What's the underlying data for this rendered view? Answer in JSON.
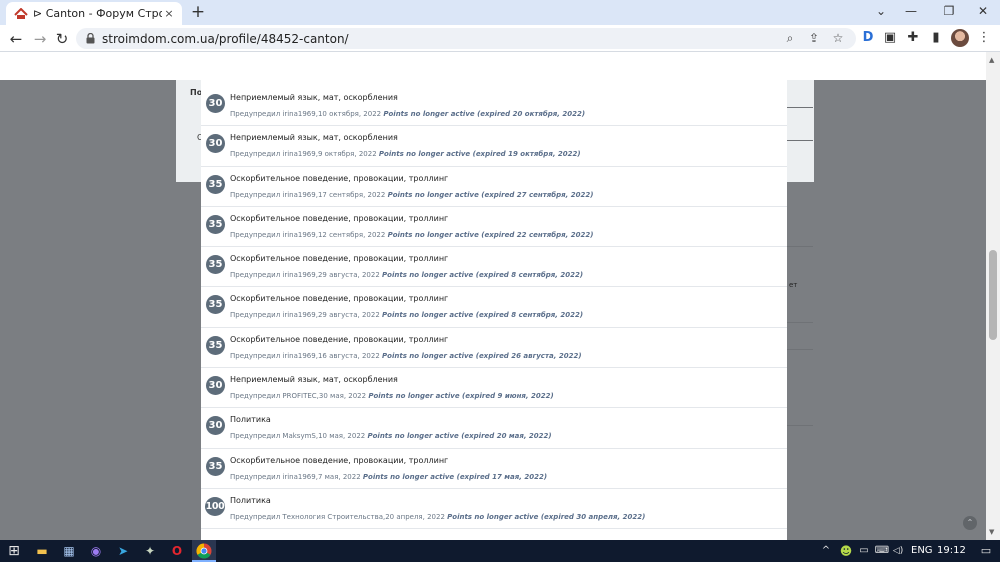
{
  "browser": {
    "tab_title": "⊳ Canton - Форум Строим Дом",
    "tab_close": "×",
    "new_tab": "+",
    "url": "stroimdom.com.ua/profile/48452-canton/",
    "buttons": {
      "back": "←",
      "forward": "→",
      "reload": "↻",
      "minimize": "—",
      "restore": "❐",
      "close": "✕",
      "dropdown": "⌄",
      "menu": "⋮"
    },
    "omnibox_icons": {
      "zoom": "⌕",
      "share": "⇪",
      "bookmark": "☆"
    },
    "extensions": [
      "D",
      "▣",
      "✚",
      "▮"
    ]
  },
  "background": {
    "card_label": "По",
    "letter": "С",
    "side_text": "ет"
  },
  "warnings": [
    {
      "points": "30",
      "reason": "Неприемлемый язык, мат, оскорбления",
      "meta": "Предупредил irina1969,10 октября, 2022",
      "status": "Points no longer active (expired 20 октября, 2022)"
    },
    {
      "points": "30",
      "reason": "Неприемлемый язык, мат, оскорбления",
      "meta": "Предупредил irina1969,9 октября, 2022",
      "status": "Points no longer active (expired 19 октября, 2022)"
    },
    {
      "points": "35",
      "reason": "Оскорбительное поведение, провокации, троллинг",
      "meta": "Предупредил irina1969,17 сентября, 2022",
      "status": "Points no longer active (expired 27 сентября, 2022)"
    },
    {
      "points": "35",
      "reason": "Оскорбительное поведение, провокации, троллинг",
      "meta": "Предупредил irina1969,12 сентября, 2022",
      "status": "Points no longer active (expired 22 сентября, 2022)"
    },
    {
      "points": "35",
      "reason": "Оскорбительное поведение, провокации, троллинг",
      "meta": "Предупредил irina1969,29 августа, 2022",
      "status": "Points no longer active (expired 8 сентября, 2022)"
    },
    {
      "points": "35",
      "reason": "Оскорбительное поведение, провокации, троллинг",
      "meta": "Предупредил irina1969,29 августа, 2022",
      "status": "Points no longer active (expired 8 сентября, 2022)"
    },
    {
      "points": "35",
      "reason": "Оскорбительное поведение, провокации, троллинг",
      "meta": "Предупредил irina1969,16 августа, 2022",
      "status": "Points no longer active (expired 26 августа, 2022)"
    },
    {
      "points": "30",
      "reason": "Неприемлемый язык, мат, оскорбления",
      "meta": "Предупредил PROFITEC,30 мая, 2022",
      "status": "Points no longer active (expired 9 июня, 2022)"
    },
    {
      "points": "30",
      "reason": "Политика",
      "meta": "Предупредил MaksymS,10 мая, 2022",
      "status": "Points no longer active (expired 20 мая, 2022)"
    },
    {
      "points": "35",
      "reason": "Оскорбительное поведение, провокации, троллинг",
      "meta": "Предупредил irina1969,7 мая, 2022",
      "status": "Points no longer active (expired 17 мая, 2022)"
    },
    {
      "points": "100",
      "reason": "Политика",
      "meta": "Предупредил Технология Строительства,20 апреля, 2022",
      "status": "Points no longer active (expired 30 апреля, 2022)"
    }
  ],
  "page": {
    "scroll_top_button": "⌃"
  },
  "taskbar": {
    "start": "⊞",
    "apps": [
      "▬",
      "▦",
      "◉",
      "➤",
      "✦",
      "O"
    ],
    "tray": [
      "^",
      "☻",
      "▭",
      "⌨",
      "◁)",
      "EN"
    ],
    "language": "ENG",
    "clock": "19:12",
    "notifications": "▭"
  },
  "colors": {
    "points_badge": "#5d6c7a",
    "status_text": "#5a6e8a",
    "overlay": "#7b7e82",
    "taskbar": "#0f1a2e"
  }
}
